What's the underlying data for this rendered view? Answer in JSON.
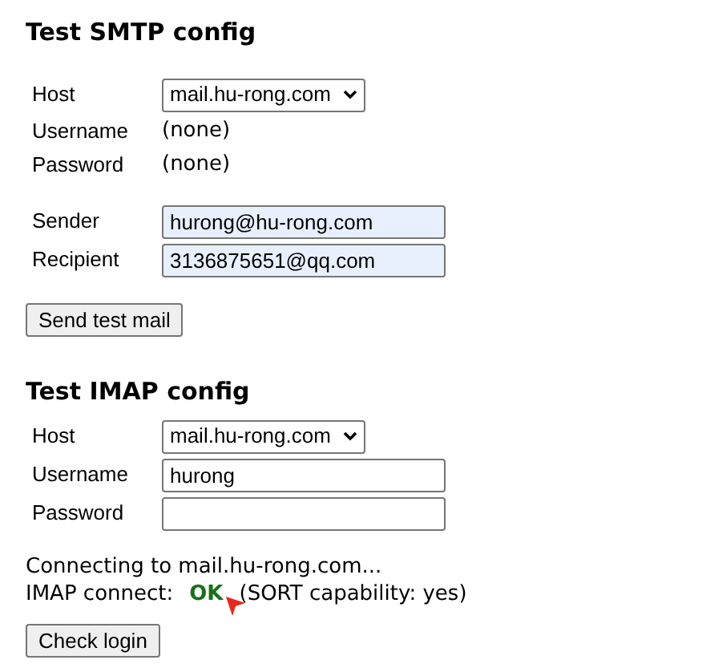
{
  "smtp": {
    "title": "Test SMTP config",
    "rows": [
      {
        "label": "Host",
        "kind": "select",
        "value": "mail.hu-rong.com"
      },
      {
        "label": "Username",
        "kind": "text",
        "value": "(none)"
      },
      {
        "label": "Password",
        "kind": "text",
        "value": "(none)"
      }
    ],
    "address_rows": [
      {
        "label": "Sender",
        "kind": "input",
        "value": "hurong@hu-rong.com",
        "autofilled": true
      },
      {
        "label": "Recipient",
        "kind": "input",
        "value": "3136875651@qq.com",
        "autofilled": true
      }
    ],
    "button": "Send test mail"
  },
  "imap": {
    "title": "Test IMAP config",
    "rows": [
      {
        "label": "Host",
        "kind": "select",
        "value": "mail.hu-rong.com"
      },
      {
        "label": "Username",
        "kind": "input",
        "value": "hurong",
        "autofilled": false
      },
      {
        "label": "Password",
        "kind": "input",
        "value": "",
        "autofilled": false
      }
    ],
    "status_lines": [
      "Connecting to mail.hu-rong.com...",
      "IMAP connect:"
    ],
    "result": "OK",
    "result_note": "(SORT capability: yes)",
    "button": "Check login"
  }
}
